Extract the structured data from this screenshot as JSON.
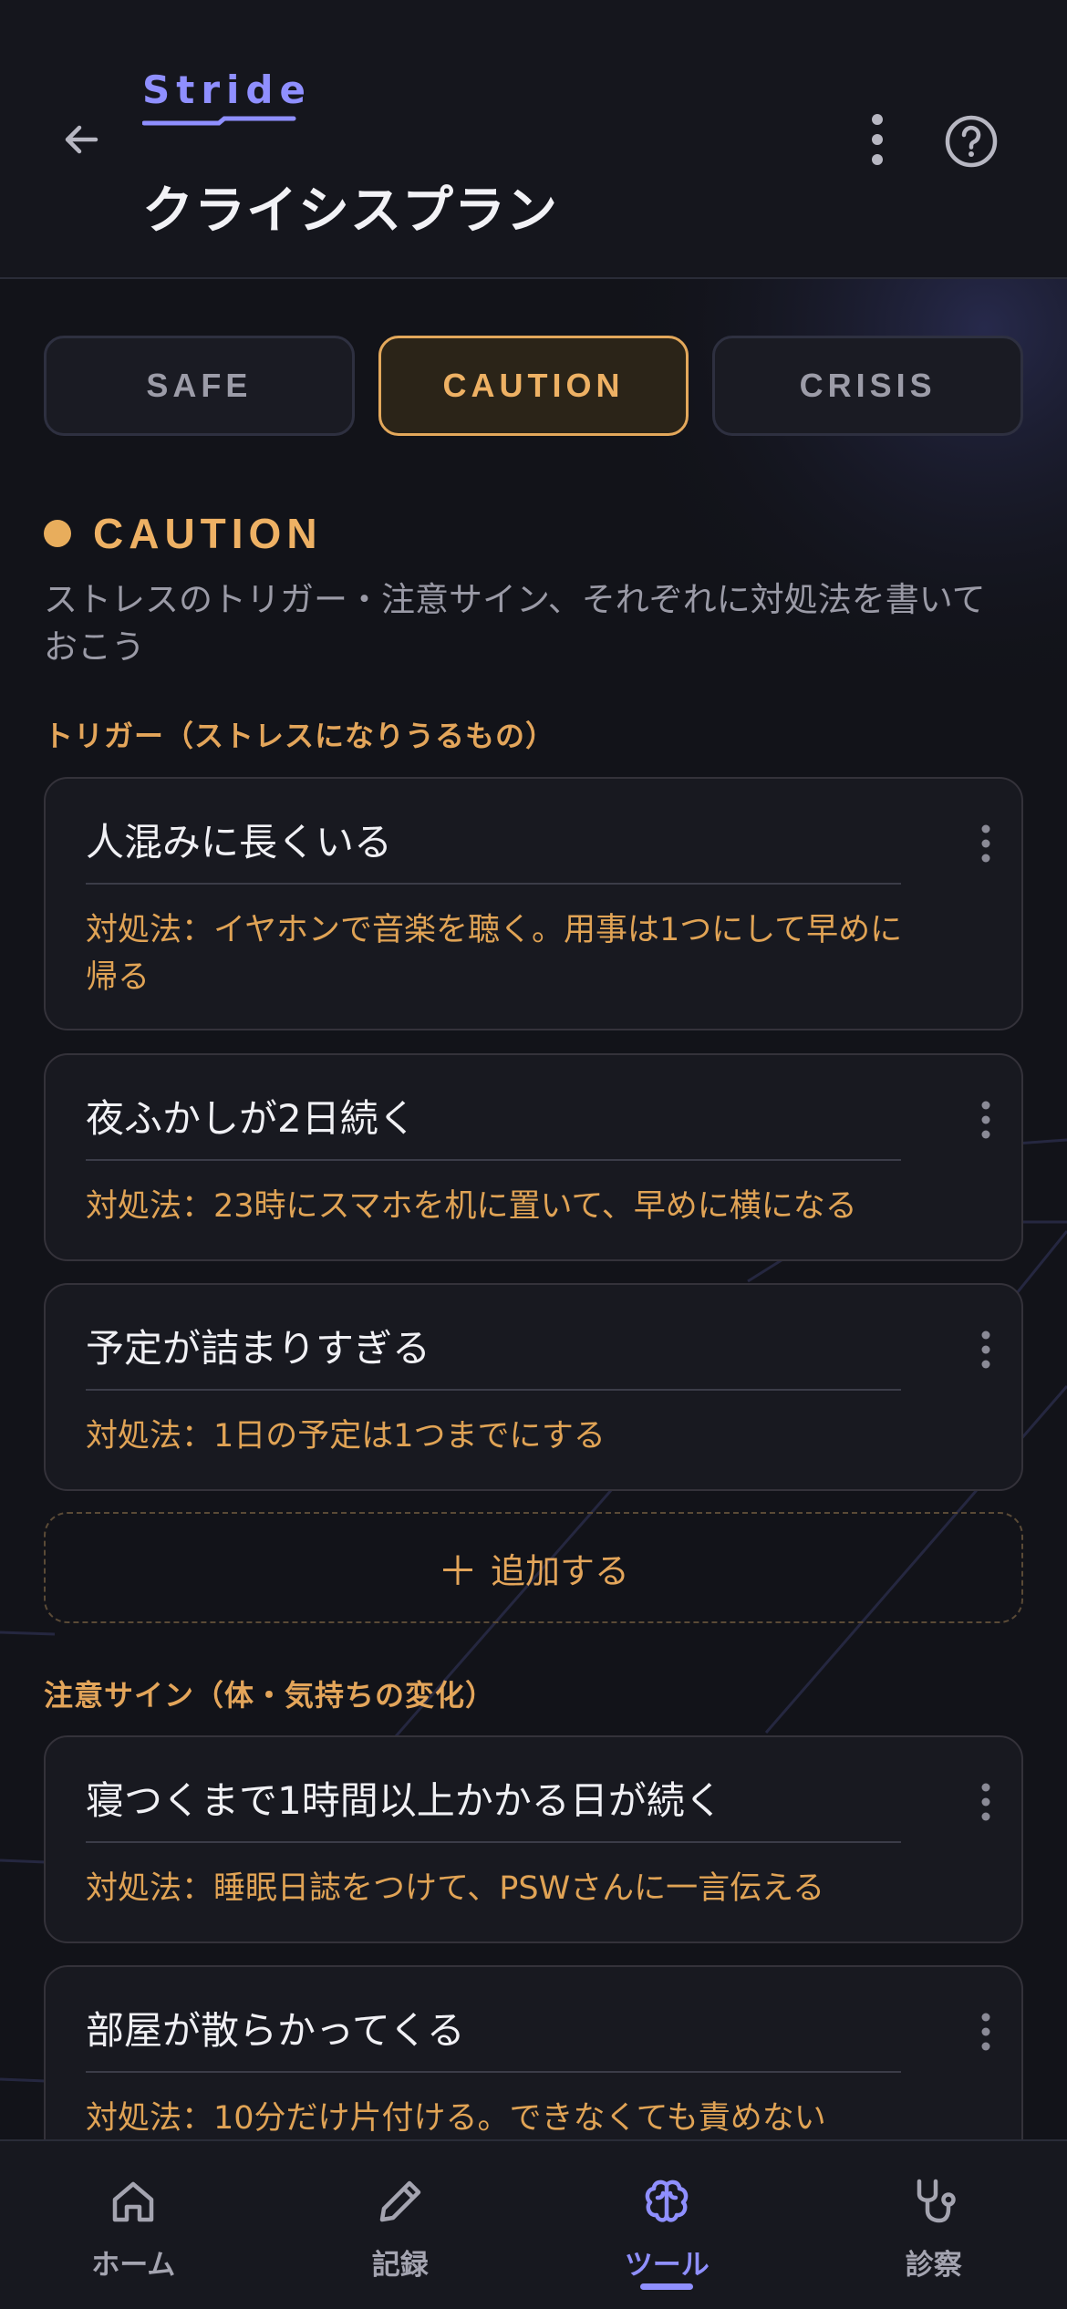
{
  "colors": {
    "background": "#121319",
    "brand": "#8f8fff",
    "caution": "#eeb164",
    "card_border": "#34323a",
    "muted_text": "#9a9aa6"
  },
  "header": {
    "brand": "Stride",
    "title": "クライシスプラン",
    "back_icon": "arrow-left-icon",
    "more_icon": "more-vertical-icon",
    "help_icon": "help-circle-icon"
  },
  "tabs": [
    {
      "label": "SAFE",
      "active": false
    },
    {
      "label": "CAUTION",
      "active": true
    },
    {
      "label": "CRISIS",
      "active": false
    }
  ],
  "section": {
    "title": "CAUTION",
    "description": "ストレスのトリガー・注意サイン、それぞれに対処法を書いておこう"
  },
  "triggers": {
    "label": "トリガー（ストレスになりうるもの）",
    "items": [
      {
        "title": "人混みに長くいる",
        "action": "対処法：イヤホンで音楽を聴く。用事は1つにして早めに帰る"
      },
      {
        "title": "夜ふかしが2日続く",
        "action": "対処法：23時にスマホを机に置いて、早めに横になる"
      },
      {
        "title": "予定が詰まりすぎる",
        "action": "対処法：1日の予定は1つまでにする"
      }
    ],
    "add_label": "追加する"
  },
  "signs": {
    "label": "注意サイン（体・気持ちの変化）",
    "items": [
      {
        "title": "寝つくまで1時間以上かかる日が続く",
        "action": "対処法：睡眠日誌をつけて、PSWさんに一言伝える"
      },
      {
        "title": "部屋が散らかってくる",
        "action": "対処法：10分だけ片付ける。できなくても責めない"
      }
    ]
  },
  "nav": [
    {
      "label": "ホーム",
      "icon": "home-icon",
      "active": false
    },
    {
      "label": "記録",
      "icon": "pencil-icon",
      "active": false
    },
    {
      "label": "ツール",
      "icon": "brain-icon",
      "active": true
    },
    {
      "label": "診察",
      "icon": "stethoscope-icon",
      "active": false
    }
  ]
}
